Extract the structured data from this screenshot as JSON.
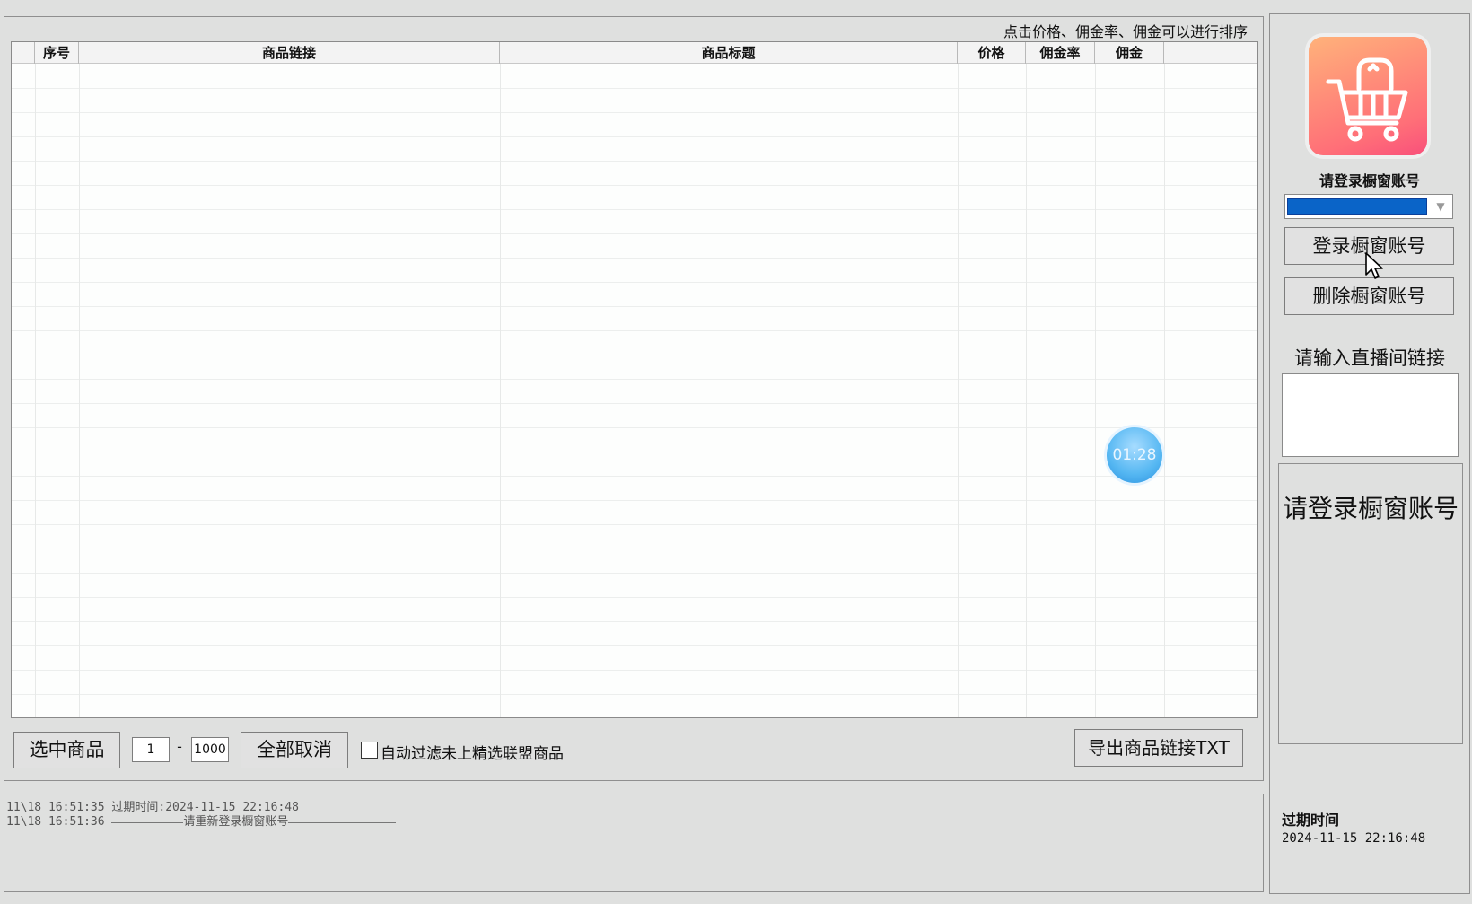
{
  "sort_hint": "点击价格、佣金率、佣金可以进行排序",
  "table": {
    "columns": [
      "",
      "序号",
      "商品链接",
      "商品标题",
      "价格",
      "佣金率",
      "佣金",
      ""
    ],
    "rows": []
  },
  "bottom": {
    "select_button": "选中商品",
    "range_start": "1",
    "range_separator": "-",
    "range_end": "1000",
    "cancel_all_button": "全部取消",
    "auto_filter_label": "自动过滤未上精选联盟商品",
    "auto_filter_checked": false,
    "export_button": "导出商品链接TXT"
  },
  "log": {
    "lines": [
      {
        "time": "11\\18 16:51:35",
        "text": "过期时间:2024-11-15 22:16:48"
      },
      {
        "time": "11\\18 16:51:36",
        "text": "请重新登录橱窗账号"
      }
    ]
  },
  "sidebar": {
    "login_prompt": "请登录橱窗账号",
    "account_selected": "",
    "login_button": "登录橱窗账号",
    "delete_button": "删除橱窗账号",
    "live_label": "请输入直播间链接",
    "live_input_value": "",
    "status_text": "请登录橱窗账号",
    "expire_label": "过期时间",
    "expire_value": "2024-11-15 22:16:48"
  },
  "overlay": {
    "timer": "01:28"
  },
  "colors": {
    "window_bg": "#dfe0df",
    "selection_blue": "#0a64c8",
    "logo_gradient_start": "#ffb27a",
    "logo_gradient_end": "#f9507b",
    "timer_blue": "#55b7f2"
  },
  "icons": {
    "logo": "shopping-cart-icon",
    "dropdown": "chevron-down-icon",
    "cursor": "mouse-pointer-icon"
  }
}
